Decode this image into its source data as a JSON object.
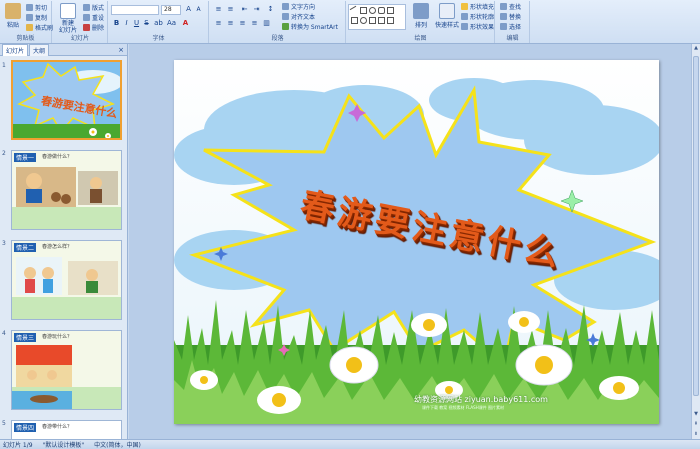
{
  "ribbon": {
    "clipboard": {
      "paste": "粘贴",
      "cut": "剪切",
      "copy": "复制",
      "format_painter": "格式刷",
      "label": "剪贴板"
    },
    "slides": {
      "new_slide": "新建\n幻灯片",
      "layout": "版式",
      "reset": "重设",
      "delete": "删除",
      "label": "幻灯片"
    },
    "font": {
      "size": "28",
      "label": "字体"
    },
    "paragraph": {
      "text_direction": "文字方向",
      "align_text": "对齐文本",
      "convert_smartart": "转换为 SmartArt",
      "label": "段落"
    },
    "drawing": {
      "arrange": "排列",
      "quick_styles": "快速样式",
      "shape_fill": "形状填充",
      "shape_outline": "形状轮廓",
      "shape_effects": "形状效果",
      "label": "绘图"
    },
    "editing": {
      "find": "查找",
      "replace": "替换",
      "select": "选择",
      "label": "编辑"
    }
  },
  "left_pane": {
    "tabs": [
      "幻灯片",
      "大纲"
    ],
    "close": "×",
    "thumbnails": [
      {
        "num": "1",
        "label": "",
        "question": ""
      },
      {
        "num": "2",
        "label": "情景一",
        "question": "春游做什么？"
      },
      {
        "num": "3",
        "label": "情景二",
        "question": "春游怎么样？"
      },
      {
        "num": "4",
        "label": "情景三",
        "question": "春游玩什么？"
      },
      {
        "num": "5",
        "label": "情景四",
        "question": "春游带什么？"
      }
    ]
  },
  "slide": {
    "title": "春游要注意什么",
    "watermark": "幼教资源网站 ziyuan.baby611.com",
    "watermark_sub": "课件下载 教案 视频素材 FLASH课件 图片素材"
  },
  "status_bar": {
    "slide_info": "幻灯片 1/9",
    "theme": "\"默认设计模板\"",
    "language": "中文(简体，中国)"
  },
  "colors": {
    "ribbon_bg": "#dbe7f7",
    "burst_fill": "#9ec8f0",
    "burst_stroke": "#f5e21a",
    "title_color": "#e35a1a",
    "selected_border": "#f0a030"
  }
}
